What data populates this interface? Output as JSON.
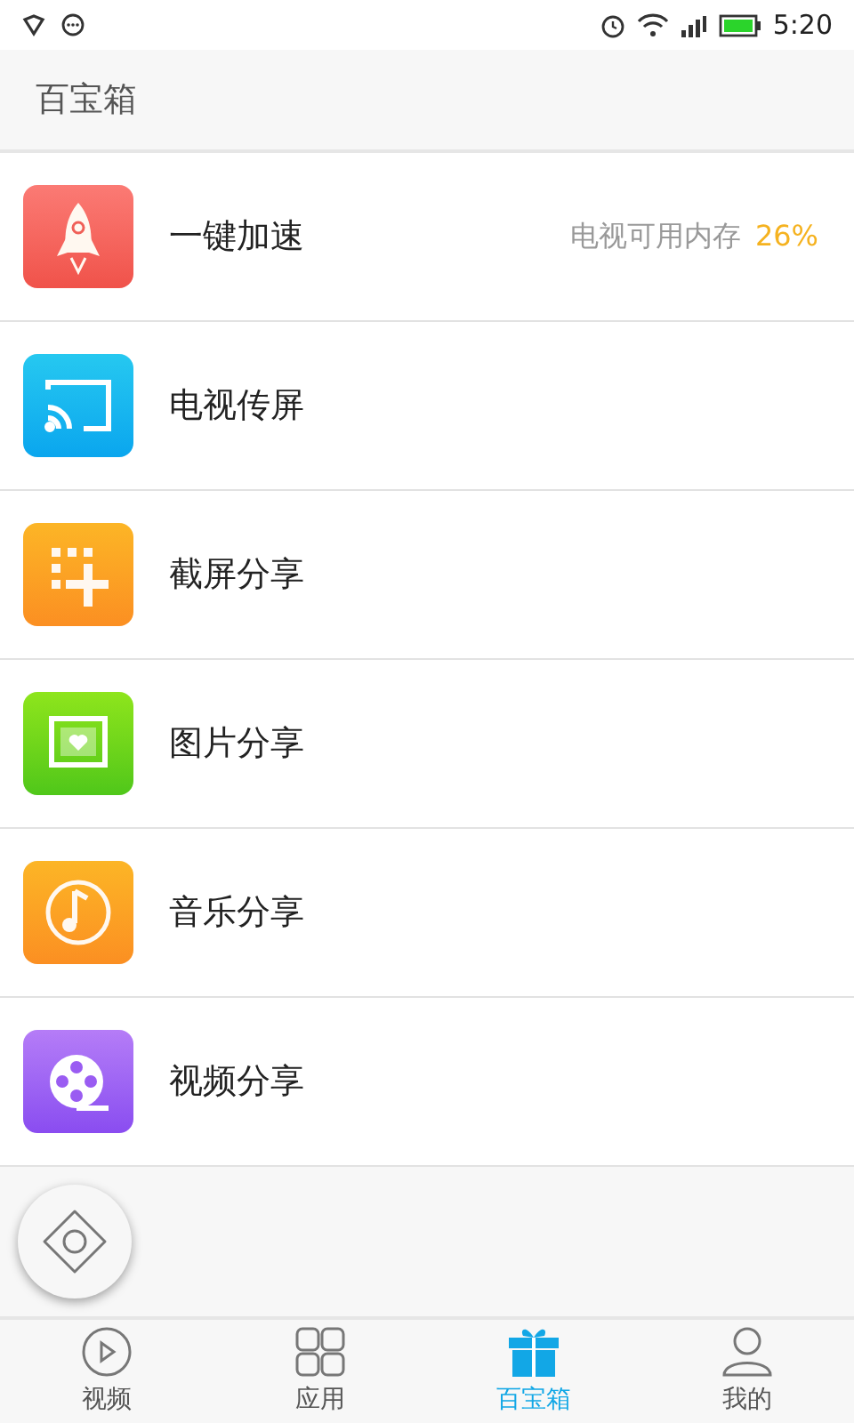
{
  "status_bar": {
    "time": "5:20"
  },
  "header": {
    "title": "百宝箱"
  },
  "items": [
    {
      "kind": "rocket",
      "label": "一键加速",
      "info": "电视可用内存",
      "value": "26%"
    },
    {
      "kind": "cast",
      "label": "电视传屏"
    },
    {
      "kind": "screenshot",
      "label": "截屏分享"
    },
    {
      "kind": "picture",
      "label": "图片分享"
    },
    {
      "kind": "music",
      "label": "音乐分享"
    },
    {
      "kind": "video",
      "label": "视频分享"
    }
  ],
  "tabs": [
    {
      "kind": "video",
      "label": "视频",
      "selected": false
    },
    {
      "kind": "apps",
      "label": "应用",
      "selected": false
    },
    {
      "kind": "gift",
      "label": "百宝箱",
      "selected": true
    },
    {
      "kind": "profile",
      "label": "我的",
      "selected": false
    }
  ]
}
